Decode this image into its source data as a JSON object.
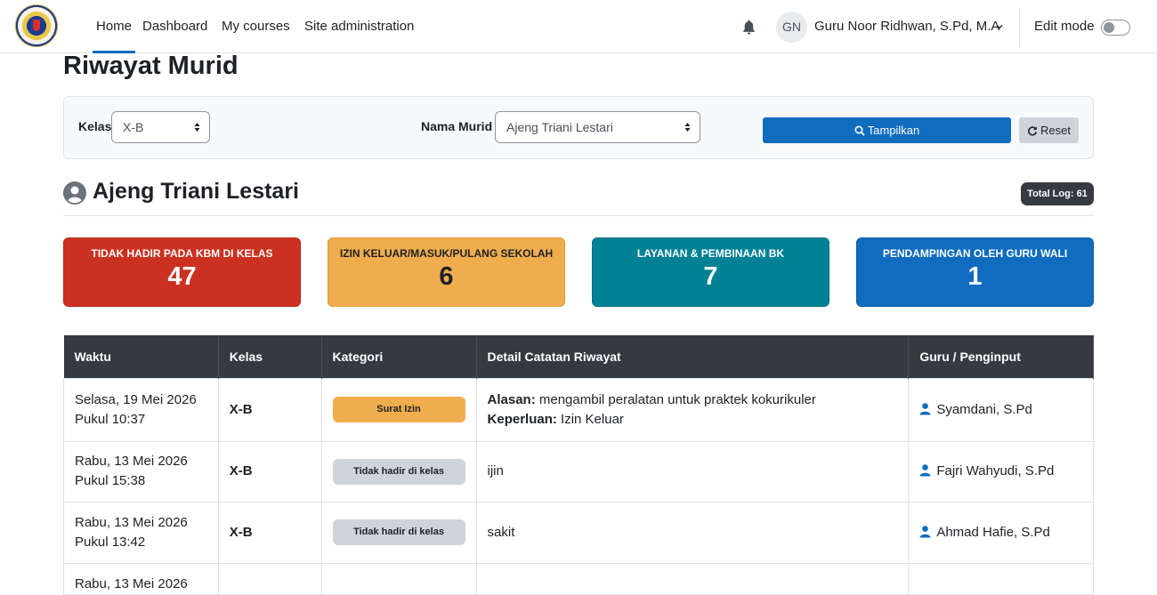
{
  "nav": {
    "items": [
      {
        "label": "Home",
        "active": true
      },
      {
        "label": "Dashboard",
        "active": false
      },
      {
        "label": "My courses",
        "active": false
      },
      {
        "label": "Site administration",
        "active": false
      }
    ],
    "bell_icon": "bell-icon",
    "user_initials": "GN",
    "user_name": "Guru Noor Ridhwan, S.Pd, M.A",
    "edit_mode_label": "Edit mode",
    "edit_mode_on": false
  },
  "page": {
    "title": "Riwayat Murid"
  },
  "filter": {
    "kelas_label": "Kelas",
    "kelas_value": "X-B",
    "murid_label": "Nama Murid",
    "murid_value": "Ajeng Triani Lestari",
    "show_button": "Tampilkan",
    "reset_button": "Reset"
  },
  "student": {
    "name": "Ajeng Triani Lestari",
    "total_log": "Total Log: 61"
  },
  "cards": [
    {
      "title": "TIDAK HADIR PADA KBM DI KELAS",
      "value": "47",
      "color": "#ca3120"
    },
    {
      "title": "IZIN KELUAR/MASUK/PULANG SEKOLAH",
      "value": "6",
      "color": "#f0ad4e"
    },
    {
      "title": "LAYANAN & PEMBINAAN BK",
      "value": "7",
      "color": "#008196"
    },
    {
      "title": "PENDAMPINGAN OLEH GURU WALI",
      "value": "1",
      "color": "#0f6cbf"
    }
  ],
  "table": {
    "headers": [
      "Waktu",
      "Kelas",
      "Kategori",
      "Detail Catatan Riwayat",
      "Guru / Penginput"
    ],
    "rows": [
      {
        "date": "Selasa, 19 Mei 2026",
        "time": "Pukul 10:37",
        "kelas": "X-B",
        "kategori": "Surat Izin",
        "alasan_label": "Alasan:",
        "alasan": "mengambil peralatan untuk praktek kokurikuler",
        "keperluan_label": "Keperluan:",
        "keperluan": "Izin Keluar",
        "guru": "Syamdani, S.Pd"
      },
      {
        "date": "Rabu, 13 Mei 2026",
        "time": "Pukul 15:38",
        "kelas": "X-B",
        "kategori": "Tidak hadir di kelas",
        "detail": "ijin",
        "guru": "Fajri Wahyudi, S.Pd"
      },
      {
        "date": "Rabu, 13 Mei 2026",
        "time": "Pukul 13:42",
        "kelas": "X-B",
        "kategori": "Tidak hadir di kelas",
        "detail": "sakit",
        "guru": "Ahmad Hafie, S.Pd"
      },
      {
        "date": "Rabu, 13 Mei 2026",
        "time": "",
        "kelas": "",
        "kategori": "",
        "detail": "",
        "guru": ""
      }
    ]
  }
}
